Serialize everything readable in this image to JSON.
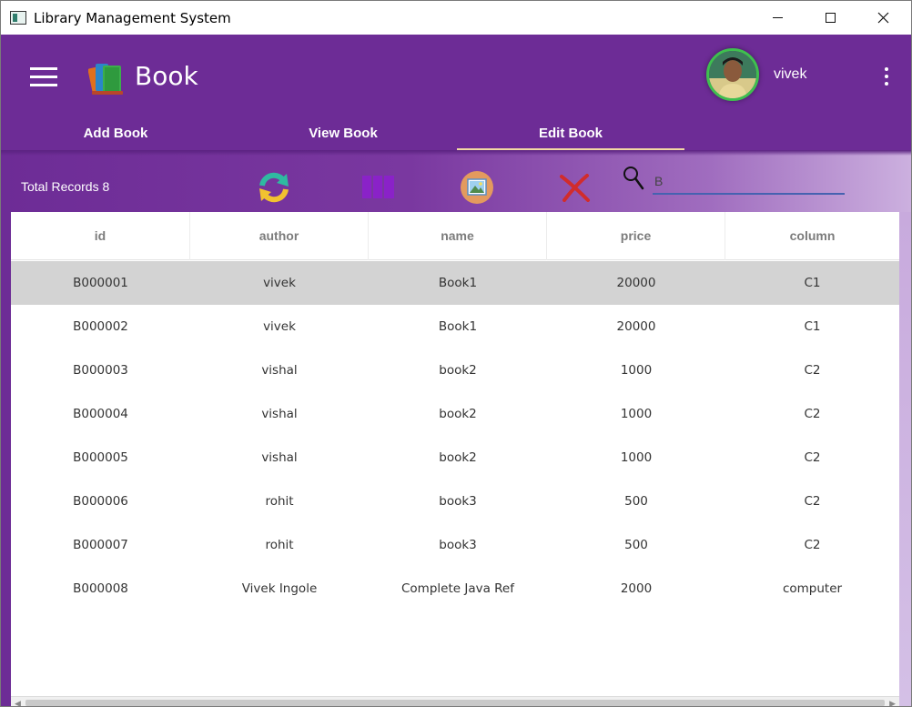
{
  "window": {
    "title": "Library Management System"
  },
  "header": {
    "page_title": "Book",
    "username": "vivek",
    "tabs": [
      {
        "label": "Add Book"
      },
      {
        "label": "View Book"
      },
      {
        "label": "Edit Book",
        "active": true
      }
    ]
  },
  "toolbar": {
    "total_records": "Total Records 8",
    "search_value": "B",
    "tools": [
      "refresh-icon",
      "columns-icon",
      "image-icon",
      "delete-icon",
      "search-icon"
    ]
  },
  "table": {
    "columns": [
      "id",
      "author",
      "name",
      "price",
      "column"
    ],
    "selected_row": 0,
    "rows": [
      [
        "B000001",
        "vivek",
        "Book1",
        "20000",
        "C1"
      ],
      [
        "B000002",
        "vivek",
        "Book1",
        "20000",
        "C1"
      ],
      [
        "B000003",
        "vishal",
        "book2",
        "1000",
        "C2"
      ],
      [
        "B000004",
        "vishal",
        "book2",
        "1000",
        "C2"
      ],
      [
        "B000005",
        "vishal",
        "book2",
        "1000",
        "C2"
      ],
      [
        "B000006",
        "rohit",
        "book3",
        "500",
        "C2"
      ],
      [
        "B000007",
        "rohit",
        "book3",
        "500",
        "C2"
      ],
      [
        "B000008",
        "Vivek Ingole",
        "Complete Java Ref",
        "2000",
        "computer"
      ]
    ]
  },
  "colors": {
    "header_purple": "#6d2c96",
    "tab_indicator": "#f3d9a4",
    "selected_row": "#d3d3d3",
    "search_underline": "#4662b0"
  }
}
